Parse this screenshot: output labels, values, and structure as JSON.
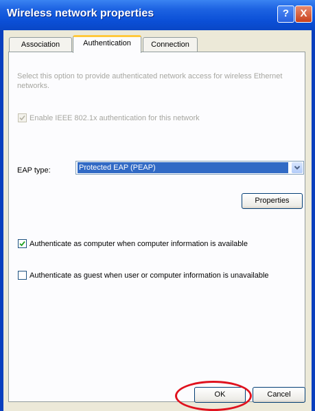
{
  "window": {
    "title": "Wireless network properties",
    "help_glyph": "?",
    "close_glyph": "X"
  },
  "tabs": [
    {
      "label": "Association",
      "active": false
    },
    {
      "label": "Authentication",
      "active": true
    },
    {
      "label": "Connection",
      "active": false
    }
  ],
  "authentication": {
    "intro_text": "Select this option to provide authenticated network access for wireless Ethernet networks.",
    "enable_8021x": {
      "label": "Enable IEEE 802.1x authentication for this network",
      "checked": true,
      "enabled": false
    },
    "eap_type_label": "EAP type:",
    "eap_type_value": "Protected EAP (PEAP)",
    "properties_button": "Properties",
    "auth_as_computer": {
      "label": "Authenticate as computer when computer information is available",
      "checked": true
    },
    "auth_as_guest": {
      "label": "Authenticate as guest when user or computer information is unavailable",
      "checked": false
    }
  },
  "buttons": {
    "ok": "OK",
    "cancel": "Cancel"
  },
  "colors": {
    "titlebar": "#0b4fd6",
    "highlight_circle": "#e0121e",
    "selection": "#316ac5"
  }
}
